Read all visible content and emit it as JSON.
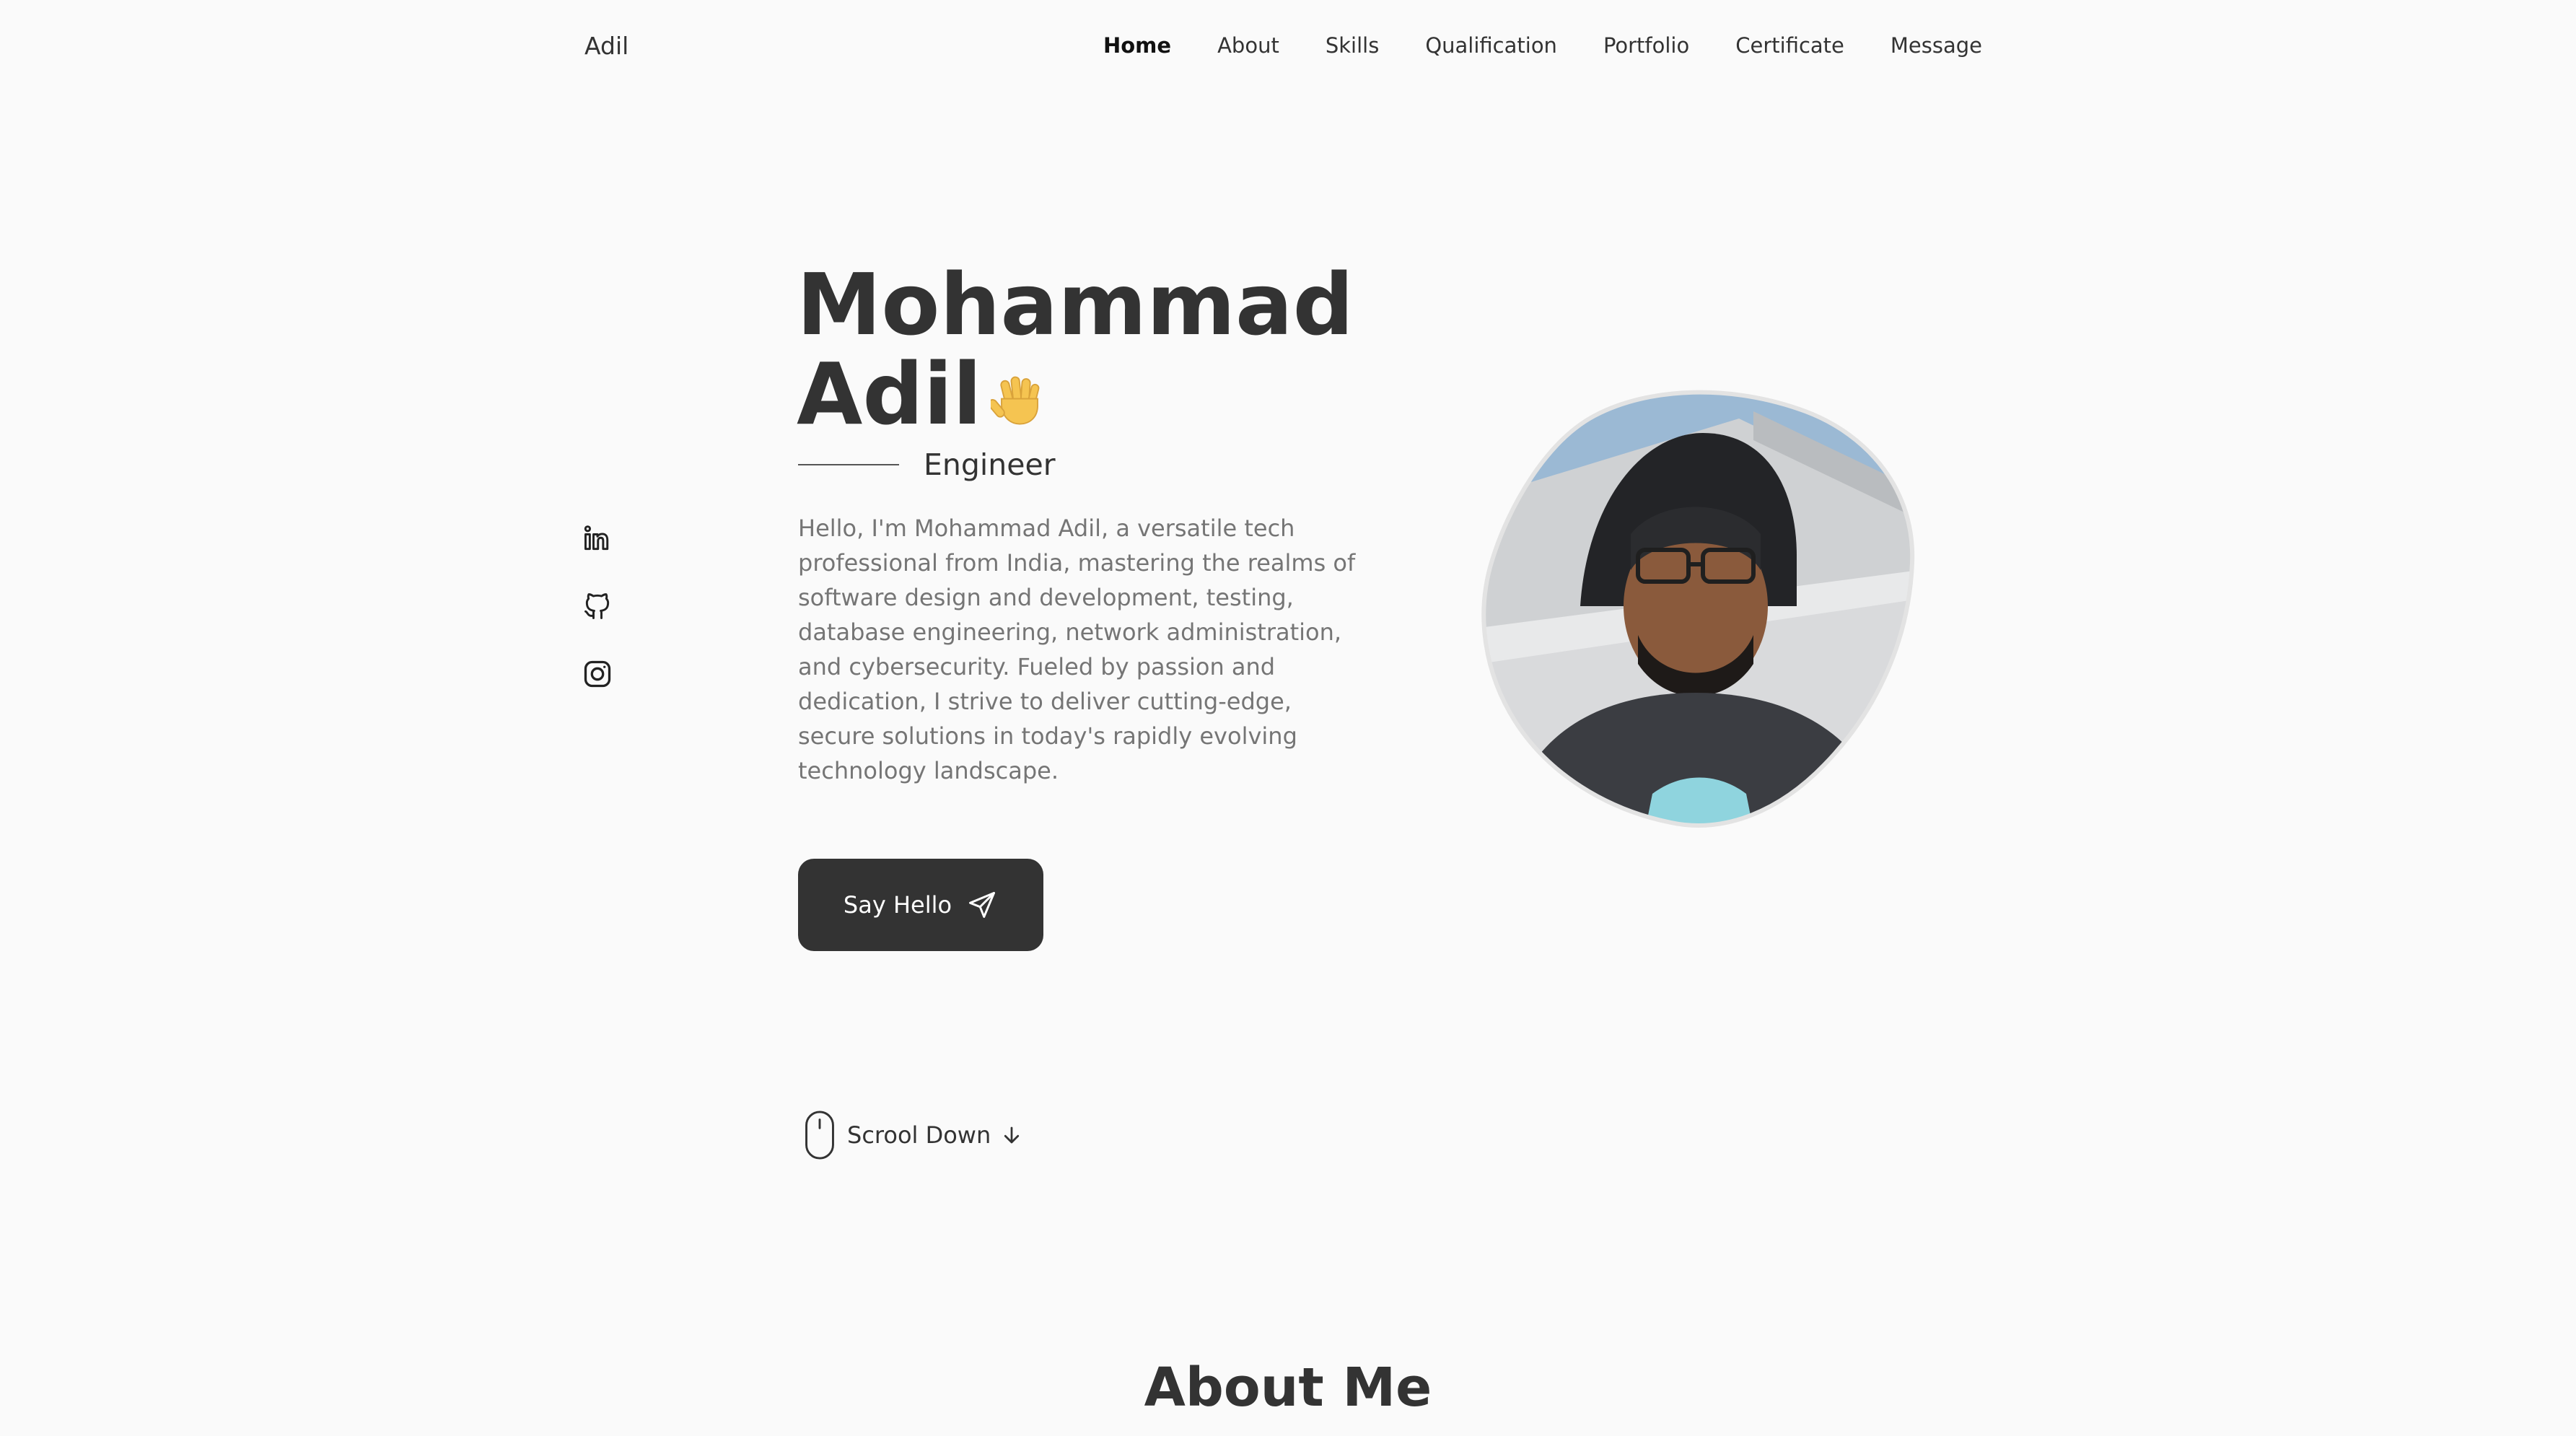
{
  "header": {
    "logo": "Adil",
    "nav": [
      {
        "label": "Home",
        "active": true
      },
      {
        "label": "About"
      },
      {
        "label": "Skills"
      },
      {
        "label": "Qualification"
      },
      {
        "label": "Portfolio"
      },
      {
        "label": "Certificate"
      },
      {
        "label": "Message"
      }
    ]
  },
  "social": {
    "icons": [
      "linkedin-icon",
      "github-icon",
      "instagram-icon"
    ]
  },
  "hero": {
    "name_line1": "Mohammad",
    "name_line2": "Adil",
    "wave_icon": "waving-hand-icon",
    "subtitle": "Engineer",
    "description": "Hello, I'm Mohammad Adil, a versatile tech professional from India, mastering the realms of software design and development, testing, database engineering, network administration, and cybersecurity. Fueled by passion and dedication, I strive to deliver cutting-edge, secure solutions in today's rapidly evolving technology landscape.",
    "cta_label": "Say Hello",
    "cta_icon": "send-icon"
  },
  "scroll": {
    "label": "Scrool Down",
    "icons": [
      "mouse-icon",
      "arrow-down-icon"
    ]
  },
  "about": {
    "title": "About Me"
  },
  "colors": {
    "background": "#fafafa",
    "text": "#333333",
    "muted": "#757575",
    "button": "#333333",
    "button_text": "#ffffff"
  }
}
